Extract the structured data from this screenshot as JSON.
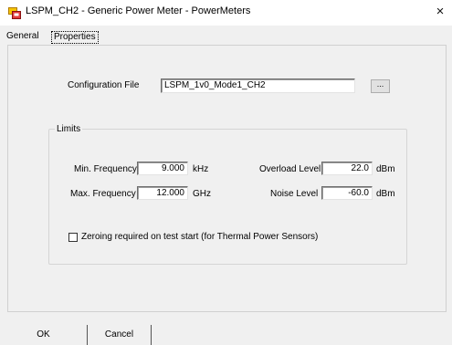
{
  "window": {
    "title": "LSPM_CH2 - Generic Power Meter - PowerMeters",
    "close_glyph": "×",
    "icon": "power-meter-app-icon"
  },
  "tabs": [
    {
      "label": "General"
    },
    {
      "label": "Properties",
      "selected": true
    }
  ],
  "config": {
    "label": "Configuration File",
    "value": "LSPM_1v0_Mode1_CH2",
    "browse_label": "..."
  },
  "limits": {
    "title": "Limits",
    "min_freq": {
      "label": "Min. Frequency",
      "value": "9.000",
      "unit": "kHz"
    },
    "max_freq": {
      "label": "Max. Frequency",
      "value": "12.000",
      "unit": "GHz"
    },
    "overload": {
      "label": "Overload Level",
      "value": "22.0",
      "unit": "dBm"
    },
    "noise": {
      "label": "Noise Level",
      "value": "-60.0",
      "unit": "dBm"
    },
    "zeroing": {
      "label": "Zeroing required on test start (for Thermal Power Sensors)",
      "checked": false
    }
  },
  "buttons": {
    "ok": "OK",
    "cancel": "Cancel"
  },
  "colors": {
    "window_bg": "#f0f0f0",
    "titlebar_bg": "#ffffff",
    "field_bg": "#ffffff"
  }
}
